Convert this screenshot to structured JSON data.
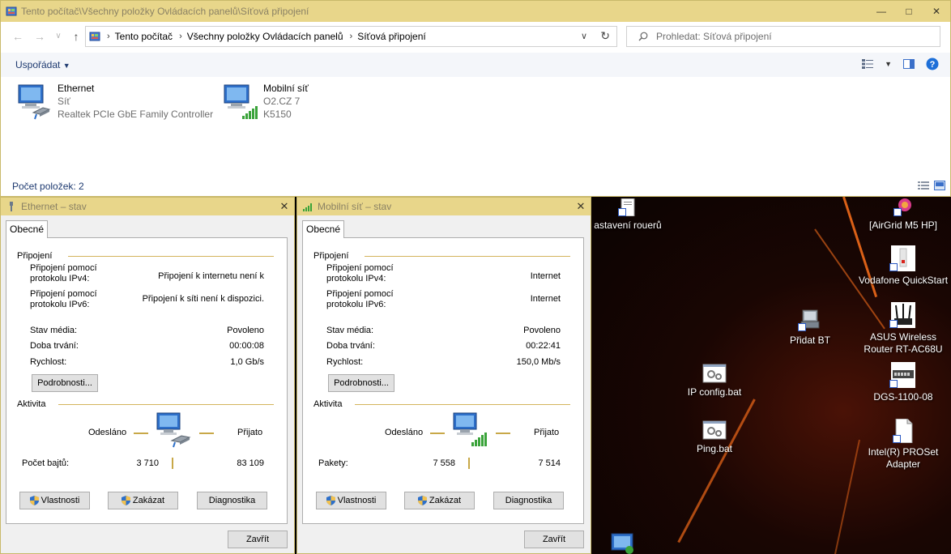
{
  "explorer": {
    "title": "Tento počítač\\Všechny položky Ovládacích panelů\\Síťová připojení",
    "breadcrumb": [
      "Tento počítač",
      "Všechny položky Ovládacích panelů",
      "Síťová připojení"
    ],
    "search_placeholder": "Prohledat: Síťová připojení",
    "organize_label": "Uspořádat",
    "status": "Počet položek: 2",
    "items": [
      {
        "name": "Ethernet",
        "line1": "Síť",
        "line2": "Realtek PCIe GbE Family Controller"
      },
      {
        "name": "Mobilní síť",
        "line1": "O2.CZ 7",
        "line2": "K5150"
      }
    ]
  },
  "dialogs": [
    {
      "title": "Ethernet – stav",
      "tab": "Obecné",
      "conn_heading": "Připojení",
      "ipv4_label": "Připojení pomocí protokolu IPv4:",
      "ipv4_value": "Připojení k internetu není k",
      "ipv6_label": "Připojení pomocí protokolu IPv6:",
      "ipv6_value": "Připojení k síti není k dispozici.",
      "media_label": "Stav média:",
      "media_value": "Povoleno",
      "duration_label": "Doba trvání:",
      "duration_value": "00:00:08",
      "speed_label": "Rychlost:",
      "speed_value": "1,0 Gb/s",
      "details_btn": "Podrobnosti...",
      "activity_heading": "Aktivita",
      "sent_label": "Odesláno",
      "recv_label": "Přijato",
      "counter_label": "Počet bajtů:",
      "sent_value": "3 710",
      "recv_value": "83 109",
      "props_btn": "Vlastnosti",
      "disable_btn": "Zakázat",
      "diag_btn": "Diagnostika",
      "close_btn": "Zavřít"
    },
    {
      "title": "Mobilní síť – stav",
      "tab": "Obecné",
      "conn_heading": "Připojení",
      "ipv4_label": "Připojení pomocí protokolu IPv4:",
      "ipv4_value": "Internet",
      "ipv6_label": "Připojení pomocí protokolu IPv6:",
      "ipv6_value": "Internet",
      "media_label": "Stav média:",
      "media_value": "Povoleno",
      "duration_label": "Doba trvání:",
      "duration_value": "00:22:41",
      "speed_label": "Rychlost:",
      "speed_value": "150,0 Mb/s",
      "details_btn": "Podrobnosti...",
      "activity_heading": "Aktivita",
      "sent_label": "Odesláno",
      "recv_label": "Přijato",
      "counter_label": "Pakety:",
      "sent_value": "7 558",
      "recv_value": "7 514",
      "props_btn": "Vlastnosti",
      "disable_btn": "Zakázat",
      "diag_btn": "Diagnostika",
      "close_btn": "Zavřít"
    }
  ],
  "desktop": {
    "icons": [
      {
        "label": "astavení rouerů"
      },
      {
        "label": "[AirGrid M5 HP]"
      },
      {
        "label": "Vodafone QuickStart"
      },
      {
        "label": "Přidat BT"
      },
      {
        "label": "ASUS Wireless Router RT-AC68U"
      },
      {
        "label": "IP config.bat"
      },
      {
        "label": "DGS-1100-08"
      },
      {
        "label": "Ping.bat"
      },
      {
        "label": "Intel(R) PROSet Adapter"
      }
    ]
  },
  "colors": {
    "titlebar": "#e8d68a",
    "accent_line": "#d4b45c",
    "signal_green": "#3aa33a",
    "link_blue": "#1e3a70"
  }
}
